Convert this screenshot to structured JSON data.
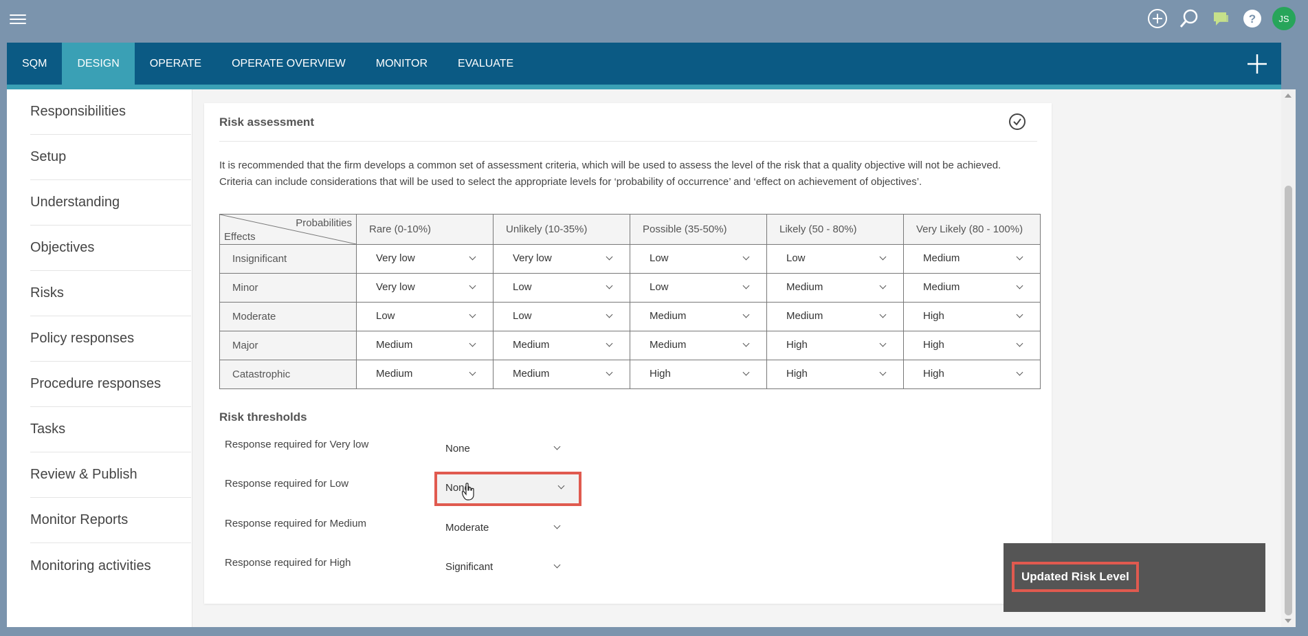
{
  "topbar": {
    "menu_icon": "hamburger-menu-icon",
    "icons": [
      "add-circle-icon",
      "search-icon",
      "chat-icon",
      "help-icon"
    ],
    "avatar_initials": "JS"
  },
  "nav": {
    "tabs": [
      {
        "label": "SQM",
        "active": false
      },
      {
        "label": "DESIGN",
        "active": true
      },
      {
        "label": "OPERATE",
        "active": false
      },
      {
        "label": "OPERATE OVERVIEW",
        "active": false
      },
      {
        "label": "MONITOR",
        "active": false
      },
      {
        "label": "EVALUATE",
        "active": false
      }
    ],
    "plus_icon": "plus-icon"
  },
  "sidebar": {
    "items": [
      {
        "label": "Responsibilities"
      },
      {
        "label": "Setup"
      },
      {
        "label": "Understanding"
      },
      {
        "label": "Objectives"
      },
      {
        "label": "Risks"
      },
      {
        "label": "Policy responses"
      },
      {
        "label": "Procedure responses"
      },
      {
        "label": "Tasks"
      },
      {
        "label": "Review & Publish"
      },
      {
        "label": "Monitor Reports"
      },
      {
        "label": "Monitoring activities"
      }
    ]
  },
  "card": {
    "title": "Risk assessment",
    "check_icon": "check-circle-icon",
    "description_line1": "It is recommended that the firm develops a common set of assessment criteria, which will be used to assess the level of the risk that a quality objective will not be achieved.",
    "description_line2": "Criteria can include considerations that will be used to select the appropriate levels for ‘probability of occurrence’ and ‘effect on achievement of objectives’."
  },
  "matrix": {
    "corner_top": "Probabilities",
    "corner_bottom": "Effects",
    "columns": [
      "Rare (0-10%)",
      "Unlikely (10-35%)",
      "Possible (35-50%)",
      "Likely (50 - 80%)",
      "Very Likely (80 - 100%)"
    ],
    "rows": [
      {
        "label": "Insignificant",
        "values": [
          "Very low",
          "Very low",
          "Low",
          "Low",
          "Medium"
        ]
      },
      {
        "label": "Minor",
        "values": [
          "Very low",
          "Low",
          "Low",
          "Medium",
          "Medium"
        ]
      },
      {
        "label": "Moderate",
        "values": [
          "Low",
          "Low",
          "Medium",
          "Medium",
          "High"
        ]
      },
      {
        "label": "Major",
        "values": [
          "Medium",
          "Medium",
          "Medium",
          "High",
          "High"
        ]
      },
      {
        "label": "Catastrophic",
        "values": [
          "Medium",
          "Medium",
          "High",
          "High",
          "High"
        ]
      }
    ]
  },
  "thresholds": {
    "title": "Risk thresholds",
    "rows": [
      {
        "label": "Response required for Very low",
        "value": "None"
      },
      {
        "label": "Response required for Low",
        "value": "None"
      },
      {
        "label": "Response required for Medium",
        "value": "Moderate"
      },
      {
        "label": "Response required for High",
        "value": "Significant"
      }
    ]
  },
  "toast": {
    "message": "Updated Risk Level"
  },
  "colors": {
    "nav_bg": "#0b5a84",
    "accent": "#3aa0b5",
    "highlight": "#e05a4f",
    "avatar": "#27a55a"
  }
}
